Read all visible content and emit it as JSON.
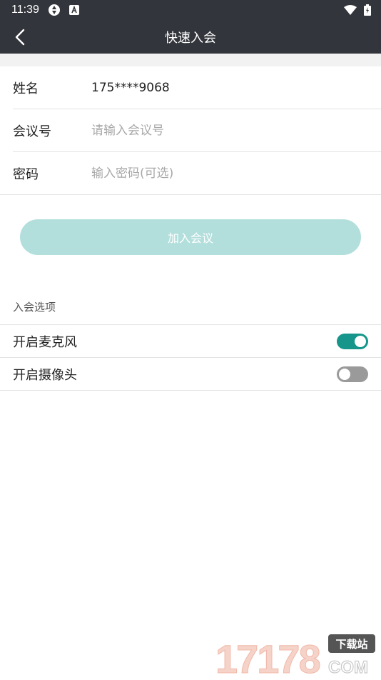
{
  "status_bar": {
    "time": "11:39",
    "left_icons": [
      "sync-icon",
      "a-icon"
    ],
    "right_icons": [
      "wifi-icon",
      "battery-icon"
    ]
  },
  "app_bar": {
    "back_icon": "back-arrow-icon",
    "title": "快速入会"
  },
  "form": {
    "name": {
      "label": "姓名",
      "value": "175****9068"
    },
    "meeting_id": {
      "label": "会议号",
      "value": "",
      "placeholder": "请输入会议号"
    },
    "password": {
      "label": "密码",
      "value": "",
      "placeholder": "输入密码(可选)"
    }
  },
  "join_button": {
    "label": "加入会议",
    "enabled": false
  },
  "options": {
    "section_title": "入会选项",
    "microphone": {
      "label": "开启麦克风",
      "on": true
    },
    "camera": {
      "label": "开启摄像头",
      "on": false
    }
  },
  "watermark": {
    "text_main": "17178",
    "text_sub": "COM",
    "badge": "下载站"
  },
  "colors": {
    "bar": "#32353b",
    "accent": "#16968a",
    "button_disabled": "#b2dfdc",
    "switch_off": "#9a9a9a"
  }
}
